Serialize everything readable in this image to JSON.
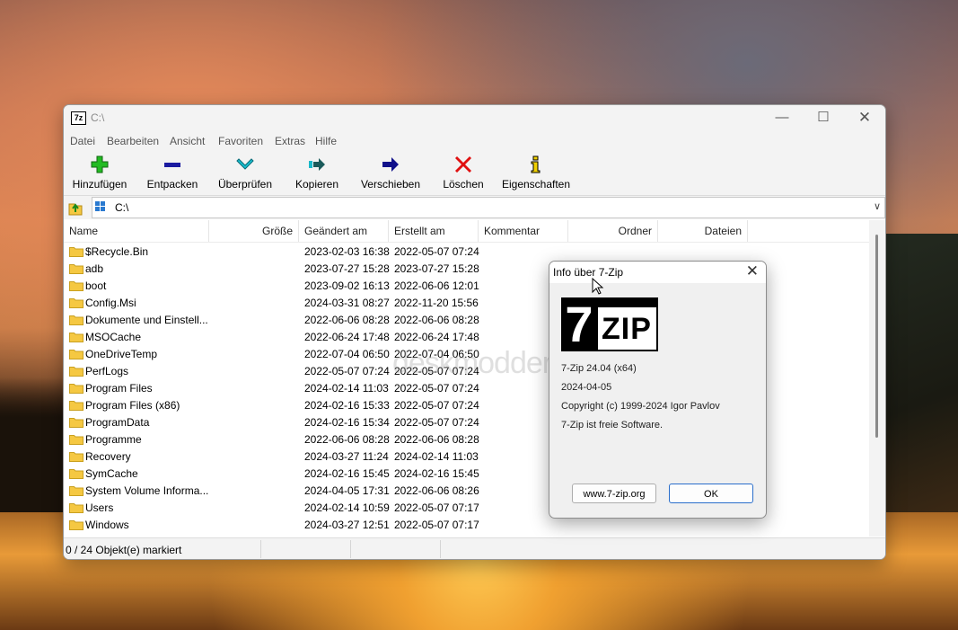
{
  "window": {
    "title": "C:\\",
    "app_icon": "7z"
  },
  "menu": [
    "Datei",
    "Bearbeiten",
    "Ansicht",
    "Favoriten",
    "Extras",
    "Hilfe"
  ],
  "toolbar": [
    {
      "label": "Hinzufügen",
      "icon": "plus-icon",
      "color": "#22aa22"
    },
    {
      "label": "Entpacken",
      "icon": "minus-icon",
      "color": "#1a1aa0"
    },
    {
      "label": "Überprüfen",
      "icon": "check-icon",
      "color": "#18a8b8"
    },
    {
      "label": "Kopieren",
      "icon": "copy-arrow-icon",
      "color": "#1a6060"
    },
    {
      "label": "Verschieben",
      "icon": "move-arrow-icon",
      "color": "#10108a"
    },
    {
      "label": "Löschen",
      "icon": "delete-x-icon",
      "color": "#e01010"
    },
    {
      "label": "Eigenschaften",
      "icon": "info-icon",
      "color": "#e0c000"
    }
  ],
  "address": {
    "path": "C:\\"
  },
  "columns": [
    "Name",
    "Größe",
    "Geändert am",
    "Erstellt am",
    "Kommentar",
    "Ordner",
    "Dateien"
  ],
  "files": [
    {
      "name": "$Recycle.Bin",
      "modified": "2023-02-03 16:38",
      "created": "2022-05-07 07:24"
    },
    {
      "name": "adb",
      "modified": "2023-07-27 15:28",
      "created": "2023-07-27 15:28"
    },
    {
      "name": "boot",
      "modified": "2023-09-02 16:13",
      "created": "2022-06-06 12:01"
    },
    {
      "name": "Config.Msi",
      "modified": "2024-03-31 08:27",
      "created": "2022-11-20 15:56"
    },
    {
      "name": "Dokumente und Einstell...",
      "modified": "2022-06-06 08:28",
      "created": "2022-06-06 08:28"
    },
    {
      "name": "MSOCache",
      "modified": "2022-06-24 17:48",
      "created": "2022-06-24 17:48"
    },
    {
      "name": "OneDriveTemp",
      "modified": "2022-07-04 06:50",
      "created": "2022-07-04 06:50"
    },
    {
      "name": "PerfLogs",
      "modified": "2022-05-07 07:24",
      "created": "2022-05-07 07:24"
    },
    {
      "name": "Program Files",
      "modified": "2024-02-14 11:03",
      "created": "2022-05-07 07:24"
    },
    {
      "name": "Program Files (x86)",
      "modified": "2024-02-16 15:33",
      "created": "2022-05-07 07:24"
    },
    {
      "name": "ProgramData",
      "modified": "2024-02-16 15:34",
      "created": "2022-05-07 07:24"
    },
    {
      "name": "Programme",
      "modified": "2022-06-06 08:28",
      "created": "2022-06-06 08:28"
    },
    {
      "name": "Recovery",
      "modified": "2024-03-27 11:24",
      "created": "2024-02-14 11:03"
    },
    {
      "name": "SymCache",
      "modified": "2024-02-16 15:45",
      "created": "2024-02-16 15:45"
    },
    {
      "name": "System Volume Informa...",
      "modified": "2024-04-05 17:31",
      "created": "2022-06-06 08:26"
    },
    {
      "name": "Users",
      "modified": "2024-02-14 10:59",
      "created": "2022-05-07 07:17"
    },
    {
      "name": "Windows",
      "modified": "2024-03-27 12:51",
      "created": "2022-05-07 07:17"
    }
  ],
  "status": {
    "text": "0 / 24 Objekt(e) markiert"
  },
  "dialog": {
    "title": "Info über 7-Zip",
    "logo_number": "7",
    "logo_text": "ZIP",
    "version": "7-Zip 24.04 (x64)",
    "date": "2024-04-05",
    "copyright": "Copyright (c) 1999-2024 Igor Pavlov",
    "license": "7-Zip ist freie Software.",
    "url_button": "www.7-zip.org",
    "ok_button": "OK"
  },
  "watermark": "deskmodder.de",
  "colors": {
    "folder": "#f5c842",
    "accent": "#2a6ecb"
  }
}
